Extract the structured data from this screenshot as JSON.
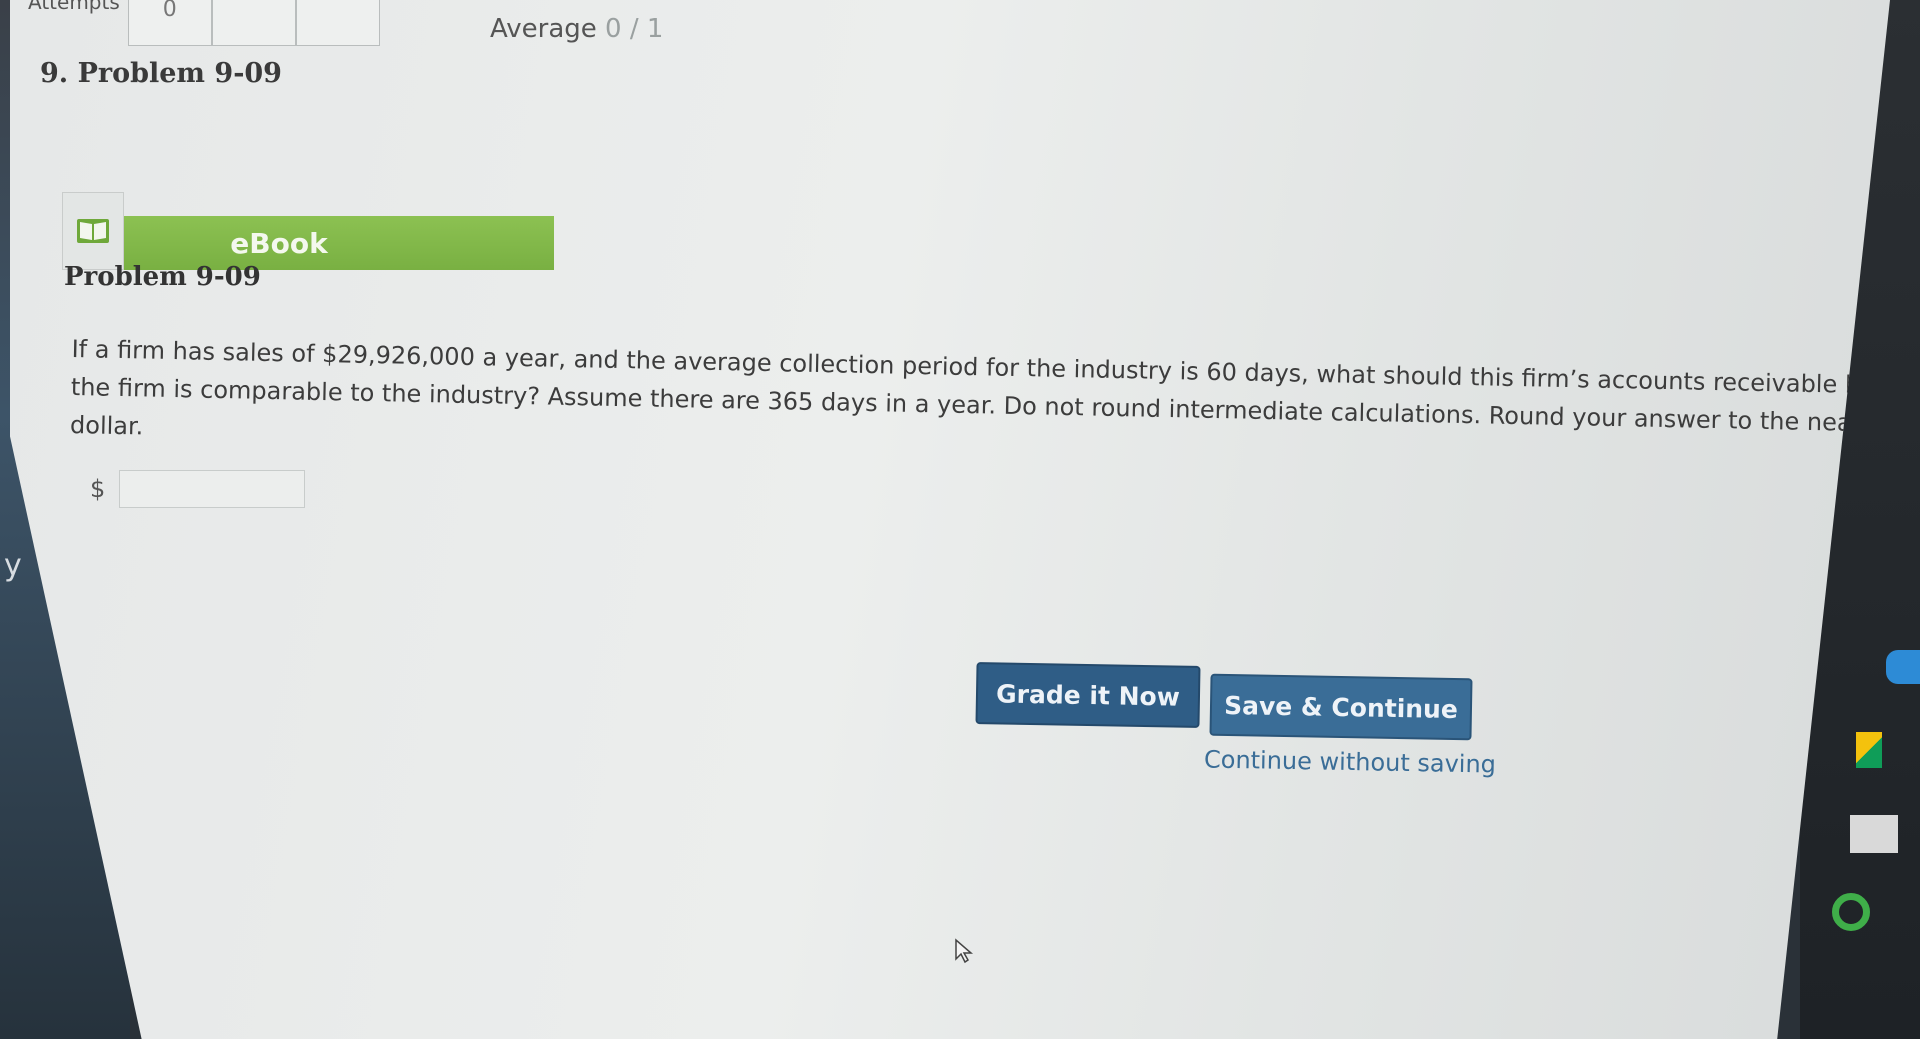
{
  "attempts": {
    "label": "Attempts",
    "value": "0"
  },
  "average": {
    "label": "Average",
    "value": "0 / 1"
  },
  "problem_header": "9. Problem 9-09",
  "ebook": {
    "label": "eBook",
    "icon": "book-icon"
  },
  "problem_title": "Problem 9-09",
  "question_text": "If a firm has sales of $29,926,000 a year, and the average collection period for the industry is 60 days, what should this firm’s accounts receivable be if the firm is comparable to the industry? Assume there are 365 days in a year. Do not round intermediate calculations. Round your answer to the nearest dollar.",
  "answer": {
    "currency": "$",
    "value": ""
  },
  "buttons": {
    "grade": "Grade it Now",
    "save": "Save & Continue",
    "continue": "Continue without saving"
  },
  "left_rail_letter": "y",
  "colors": {
    "ebook_green": "#8cc152",
    "button_blue": "#2f5d86",
    "link_blue": "#3a6d97"
  }
}
